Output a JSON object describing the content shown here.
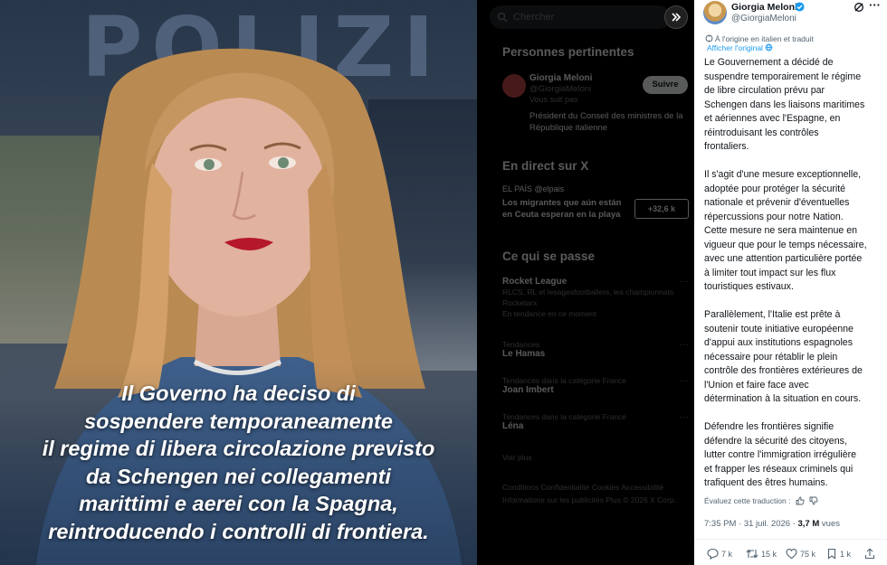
{
  "media": {
    "banner_text": "POLIZI",
    "caption_lines": [
      "Il Governo ha deciso di",
      "sospendere temporaneamente",
      "il regime di libera circolazione previsto",
      "da Schengen nei collegamenti",
      "marittimi e aerei con la Spagna,",
      "reintroducendo i controlli di frontiera."
    ]
  },
  "sidebar": {
    "search_placeholder": "Chercher",
    "relevant": {
      "title": "Personnes pertinentes",
      "name": "Giorgia Meloni",
      "handle": "@GiorgiaMeloni",
      "follows_you": "Vous suit pas",
      "bio": "Président du Conseil des ministres de la République italienne",
      "follow_label": "Suivre"
    },
    "live": {
      "title": "En direct sur X",
      "source": "EL PAÍS  @elpais",
      "headline": "Los migrantes que aún están en Ceuta esperan en la playa",
      "badge": "+32,6 k"
    },
    "trends_title": "Ce qui se passe",
    "trends": [
      {
        "context": "",
        "name": "Rocket League",
        "sub": "RLCS, RL et lesagesfootballers, les championnats Rocketarx",
        "extra": "En tendance en ce moment"
      },
      {
        "context": "Tendances",
        "name": "Le Hamas",
        "sub": "",
        "extra": ""
      },
      {
        "context": "Tendances dans la catégorie France",
        "name": "Joan Imbert",
        "sub": "",
        "extra": ""
      },
      {
        "context": "Tendances dans la catégorie France",
        "name": "Léna",
        "sub": "",
        "extra": ""
      }
    ],
    "show_more": "Voir plus",
    "footer": "Conditions   Confidentialité   Cookies   Accessibilité   Informations sur les publicités   Plus   © 2026 X Corp."
  },
  "tweet": {
    "author_name": "Giorgia Meloni",
    "author_handle": "@GiorgiaMeloni",
    "translated_note": "À l'origine en italien et traduit",
    "show_original": "Afficher l'original",
    "paragraphs": [
      "Le Gouvernement a décidé de\nsuspendre temporairement le régime\nde libre circulation prévu par\nSchengen dans les liaisons maritimes\net aériennes avec l'Espagne, en\nréintroduisant les contrôles\nfrontaliers.",
      "Il s'agit d'une mesure exceptionnelle,\nadoptée pour protéger la sécurité\nnationale et prévenir d'éventuelles\nrépercussions pour notre Nation.\nCette mesure ne sera maintenue en\nvigueur que pour le temps nécessaire,\navec une attention particulière portée\nà limiter tout impact sur les flux\ntouristiques estivaux.",
      "Parallèlement, l'Italie est prête à\nsoutenir toute initiative européenne\nd'appui aux institutions espagnoles\nnécessaire pour rétablir le plein\ncontrôle des frontières extérieures de\nl'Union et faire face avec\ndétermination à la situation en cours.",
      "Défendre les frontières signifie\ndéfendre la sécurité des citoyens,\nlutter contre l'immigration irrégulière\net frapper les réseaux criminels qui\ntrafiquent des êtres humains."
    ],
    "rate_translation": "Évaluez cette traduction :",
    "time": "7:35 PM · 31 juil. 2026 · ",
    "views_count": "3,7 M",
    "views_label": " vues",
    "replies": "7 k",
    "reposts": "15 k",
    "likes": "75 k",
    "bookmarks": "1 k"
  },
  "colors": {
    "link_blue": "#1d9bf0",
    "verified_blue": "#1d9bf0",
    "muted_text": "#536471"
  }
}
